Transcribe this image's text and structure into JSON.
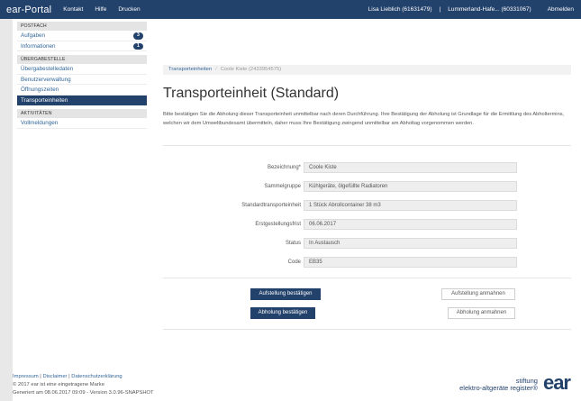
{
  "topbar": {
    "logo": "ear-Portal",
    "nav": [
      "Kontakt",
      "Hilfe",
      "Drucken"
    ],
    "user": "Lisa Lieblich (61631479)",
    "divider": "|",
    "company": "Lummerland-Hafe... (60331067)",
    "logout": "Abmelden"
  },
  "sidebar": {
    "sections": [
      {
        "header": "Postfach",
        "items": [
          {
            "label": "Aufgaben",
            "badge": "3"
          },
          {
            "label": "Informationen",
            "badge": "1"
          }
        ]
      },
      {
        "header": "Übergabestelle",
        "items": [
          {
            "label": "Übergabestelledaten"
          },
          {
            "label": "Benutzerverwaltung"
          },
          {
            "label": "Öffnungszeiten"
          },
          {
            "label": "Transporteinheiten",
            "active": true
          }
        ]
      },
      {
        "header": "Aktivitäten",
        "items": [
          {
            "label": "Vollmeldungen"
          }
        ]
      }
    ]
  },
  "breadcrumb": {
    "parent": "Transporteinheiten",
    "separator": "/",
    "current": "Coole Kiste (2433954575)"
  },
  "main": {
    "title": "Transporteinheit (Standard)",
    "intro": "Bitte bestätigen Sie die Abholung dieser Transporteinheit unmittelbar nach deren Durchführung. Ihre Bestätigung der Abholung ist Grundlage für die Ermittlung des Abholtermins, welchen wir dem Umweltbundesamt übermitteln, daher muss Ihre Bestätigung zwingend unmittelbar am Abholtag vorgenommen werden.",
    "fields": [
      {
        "label": "Bezeichnung*",
        "value": "Coole Kiste"
      },
      {
        "label": "Sammelgruppe",
        "value": "Kühlgeräte, ölgefüllte Radiatoren"
      },
      {
        "label": "Standardtransporteinheit",
        "value": "1 Stück Abrollcontainer 38 m3"
      },
      {
        "label": "Erstgestellungsfrist",
        "value": "06.06.2017"
      },
      {
        "label": "Status",
        "value": "In Austausch"
      },
      {
        "label": "Code",
        "value": "EB35"
      }
    ],
    "buttons": {
      "confirm_setup": "Aufstellung bestätigen",
      "confirm_pickup": "Abholung bestätigen",
      "remind_setup": "Aufstellung anmahnen",
      "remind_pickup": "Abholung anmahnen"
    }
  },
  "footer": {
    "links": [
      "Impressum",
      "Disclaimer",
      "Datenschutzerklärung"
    ],
    "link_separator": "|",
    "copyright": "© 2017 ear ist eine eingetragene Marke",
    "generated": "Generiert am 08.06.2017 09:09 - Version 3.0.96-SNAPSHOT"
  },
  "brand": {
    "line1": "stiftung",
    "line2": "elektro-altgeräte register®",
    "mark": "ear"
  },
  "colors": {
    "brand": "#22416b",
    "link": "#336699",
    "page_bg": "#e8e8e8"
  }
}
